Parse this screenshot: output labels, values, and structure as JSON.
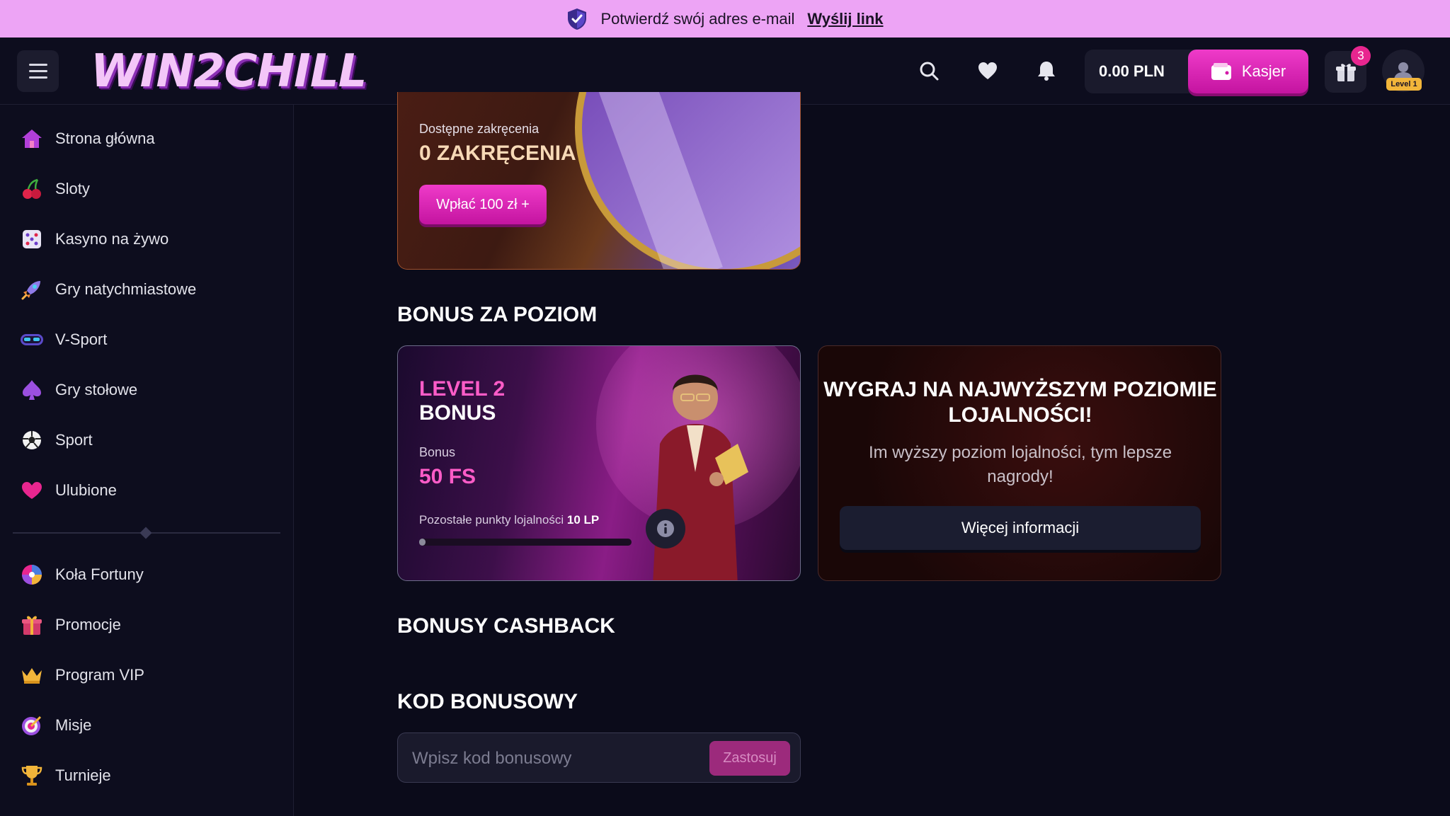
{
  "banner": {
    "message": "Potwierdź swój adres e-mail",
    "link": "Wyślij link"
  },
  "header": {
    "logo": "WIN2CHILL",
    "balance": "0.00 PLN",
    "cashier_label": "Kasjer",
    "gift_badge": "3",
    "level_tag": "Level 1"
  },
  "sidebar": {
    "items": [
      {
        "label": "Strona główna",
        "icon": "home-icon"
      },
      {
        "label": "Sloty",
        "icon": "cherry-icon"
      },
      {
        "label": "Kasyno na żywo",
        "icon": "dice-icon"
      },
      {
        "label": "Gry natychmiastowe",
        "icon": "rocket-icon"
      },
      {
        "label": "V-Sport",
        "icon": "vr-goggles-icon"
      },
      {
        "label": "Gry stołowe",
        "icon": "spade-icon"
      },
      {
        "label": "Sport",
        "icon": "soccer-ball-icon"
      },
      {
        "label": "Ulubione",
        "icon": "heart-icon"
      }
    ],
    "items2": [
      {
        "label": "Koła Fortuny",
        "icon": "fortune-wheel-icon"
      },
      {
        "label": "Promocje",
        "icon": "gift-icon"
      },
      {
        "label": "Program VIP",
        "icon": "crown-icon"
      },
      {
        "label": "Misje",
        "icon": "target-icon"
      },
      {
        "label": "Turnieje",
        "icon": "trophy-icon"
      }
    ]
  },
  "spins": {
    "label": "Dostępne zakręcenia",
    "count": "0 ZAKRĘCENIA",
    "button": "Wpłać 100 zł +"
  },
  "level_section": {
    "title": "BONUS ZA POZIOM",
    "card": {
      "title_line1": "LEVEL 2",
      "title_line2": "BONUS",
      "bonus_label": "Bonus",
      "bonus_value": "50 FS",
      "points_label": "Pozostałe punkty lojalności",
      "points_value": "10 LP",
      "progress": 0.02
    },
    "loyalty": {
      "title": "WYGRAJ NA NAJWYŻSZYM POZIOMIE LOJALNOŚCI!",
      "text": "Im wyższy poziom lojalności, tym lepsze nagrody!",
      "button": "Więcej informacji"
    }
  },
  "cashback_section": {
    "title": "BONUSY CASHBACK"
  },
  "code_section": {
    "title": "KOD BONUSOWY",
    "placeholder": "Wpisz kod bonusowy",
    "value": "",
    "apply": "Zastosuj"
  }
}
